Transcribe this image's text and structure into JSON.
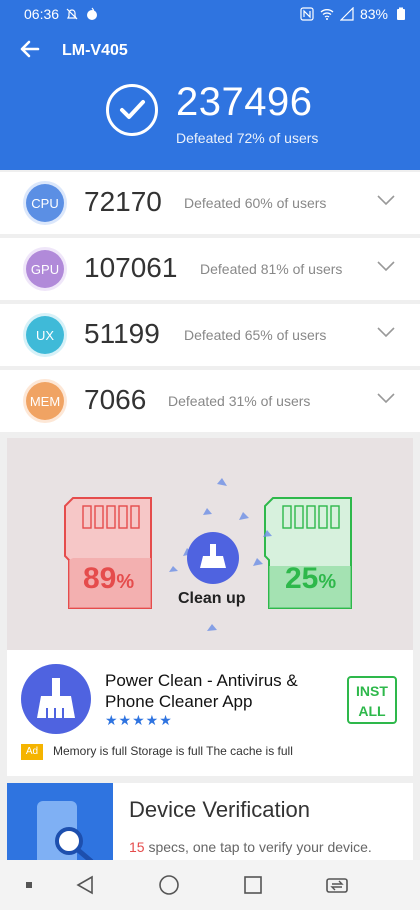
{
  "status": {
    "time": "06:36",
    "battery": "83%"
  },
  "header": {
    "title": "LM-V405",
    "score": "237496",
    "score_sub": "Defeated 72% of users"
  },
  "scores": [
    {
      "label": "CPU",
      "value": "72170",
      "desc": "Defeated 60% of users",
      "color": "#5b8fe4"
    },
    {
      "label": "GPU",
      "value": "107061",
      "desc": "Defeated 81% of users",
      "color": "#b18ad9"
    },
    {
      "label": "UX",
      "value": "51199",
      "desc": "Defeated 65% of users",
      "color": "#3fbad8"
    },
    {
      "label": "MEM",
      "value": "7066",
      "desc": "Defeated 31% of users",
      "color": "#f0a363"
    }
  ],
  "ad": {
    "left_percent": "89",
    "right_percent": "25",
    "percent_sign": "%",
    "clean_label": "Clean up",
    "app_title": "Power Clean - Antivirus & Phone Cleaner App",
    "rating_stars": "★★★★★",
    "install_line1": "INST",
    "install_line2": "ALL",
    "ad_tag": "Ad",
    "ad_line": "Memory is full Storage is full The cache is full"
  },
  "device_verification": {
    "title": "Device Verification",
    "count": "15",
    "sub": " specs, one tap to verify your device."
  },
  "colors": {
    "primary": "#2f74e0",
    "red": "#e54c4c",
    "green": "#2eb84b"
  }
}
